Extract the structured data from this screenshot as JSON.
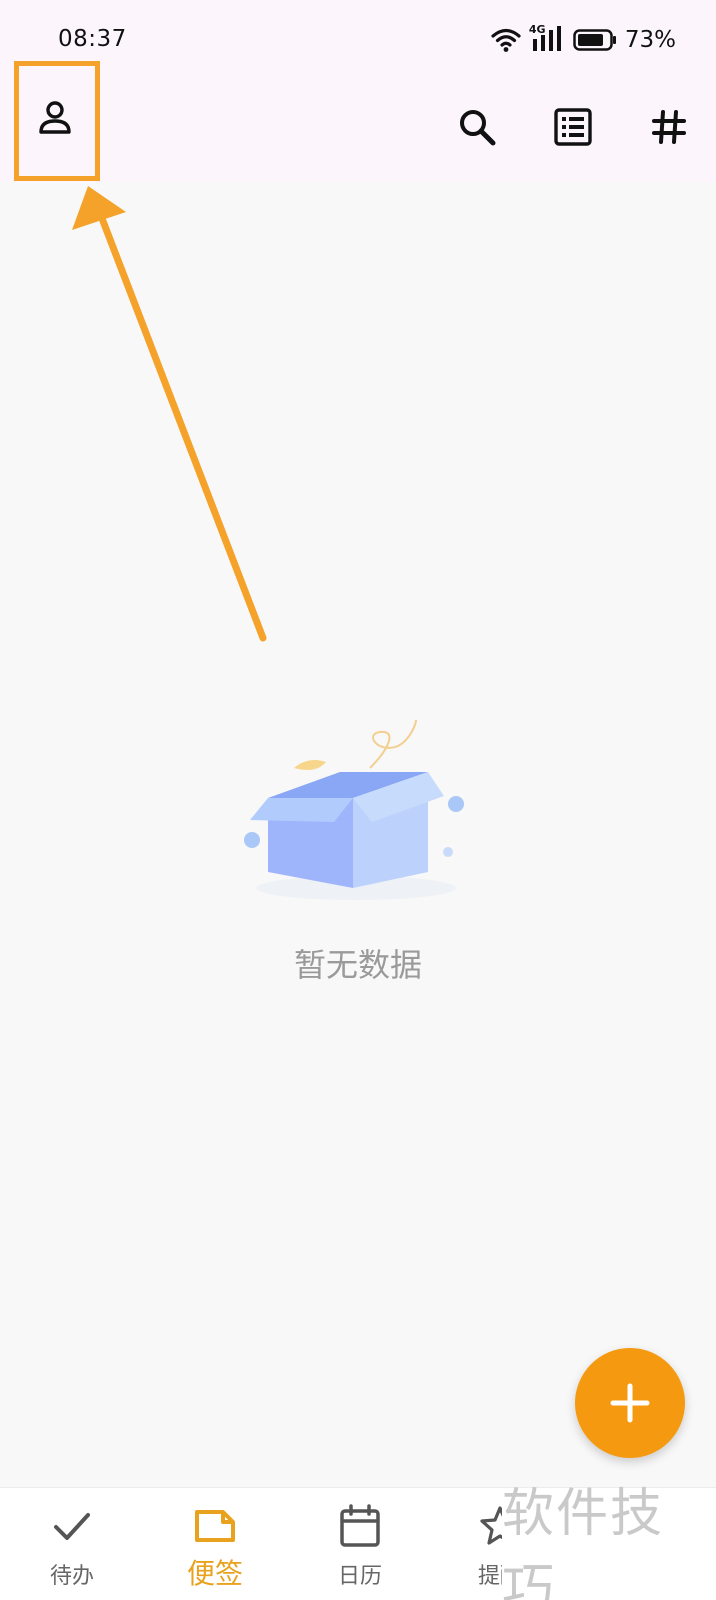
{
  "status_bar": {
    "time": "08:37",
    "network": "4G",
    "battery": "73%"
  },
  "top_bar": {
    "icons": [
      "person-icon",
      "search-icon",
      "list-view-icon",
      "hashtag-icon"
    ]
  },
  "empty_state": {
    "message": "暂无数据"
  },
  "fab": {
    "icon": "plus-icon"
  },
  "bottom_nav": {
    "items": [
      {
        "label": "待办",
        "icon": "check-icon"
      },
      {
        "label": "便签",
        "icon": "note-icon",
        "active": true
      },
      {
        "label": "日历",
        "icon": "calendar-icon"
      },
      {
        "label": "提醒",
        "icon": "star-icon"
      }
    ]
  },
  "watermark": {
    "text": "软件技巧"
  },
  "colors": {
    "accent": "#f59a10",
    "active_label": "#e9a21e",
    "highlight": "#f4a22a",
    "header_bg": "#fcf6fc",
    "page_bg": "#f8f8f8"
  }
}
